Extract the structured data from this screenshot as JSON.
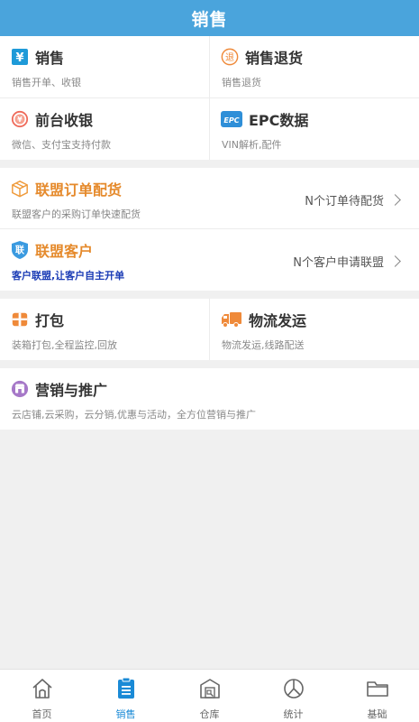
{
  "header": {
    "title": "销售"
  },
  "grid1": [
    [
      {
        "title": "销售",
        "subtitle": "销售开单、收银",
        "icon": "yen-icon"
      },
      {
        "title": "销售退货",
        "subtitle": "销售退货",
        "icon": "return-icon"
      }
    ],
    [
      {
        "title": "前台收银",
        "subtitle": "微信、支付宝支持付款",
        "icon": "cashier-icon"
      },
      {
        "title": "EPC数据",
        "subtitle": "VIN解析,配件",
        "icon": "epc-icon"
      }
    ]
  ],
  "alliance": [
    {
      "title": "联盟订单配货",
      "subtitle": "联盟客户的采购订单快速配货",
      "right": "N个订单待配货",
      "icon": "box-icon"
    },
    {
      "title": "联盟客户",
      "subtitle": "客户联盟,让客户自主开单",
      "right": "N个客户申请联盟",
      "icon": "shield-icon"
    }
  ],
  "grid2": [
    {
      "title": "打包",
      "subtitle": "装箱打包,全程监控,回放",
      "icon": "package-icon"
    },
    {
      "title": "物流发运",
      "subtitle": "物流发运,线路配送",
      "icon": "truck-icon"
    }
  ],
  "marketing": {
    "title": "营销与推广",
    "subtitle": "云店铺,云采购，云分销,优惠与活动，全方位营销与推广",
    "icon": "store-icon"
  },
  "tabs": [
    {
      "label": "首页",
      "icon": "home-icon",
      "active": false
    },
    {
      "label": "销售",
      "icon": "clipboard-icon",
      "active": true
    },
    {
      "label": "仓库",
      "icon": "warehouse-icon",
      "active": false
    },
    {
      "label": "统计",
      "icon": "chart-icon",
      "active": false
    },
    {
      "label": "基础",
      "icon": "folder-icon",
      "active": false
    }
  ],
  "colors": {
    "header": "#4aa4dc",
    "accent": "#1a8ad6",
    "orange": "#e58a2c",
    "blue_text": "#1a3bb5"
  }
}
